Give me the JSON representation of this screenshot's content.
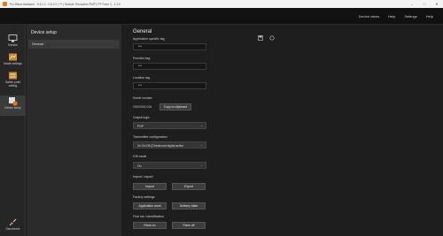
{
  "window": {
    "title": "Pro Warm Assistant - 9.3.1.0 - 2.8.2.0 | *** | Module: Receptive IPMT1 PF Ports *) - 1.2.0",
    "controls": [
      "–",
      "□",
      "✕"
    ]
  },
  "topmenu": {
    "items": [
      "Device views",
      "Help",
      "Settings",
      "Help"
    ]
  },
  "nav": {
    "items": [
      {
        "label": "Monitor",
        "icon": "monitor-icon"
      },
      {
        "label": "Model settings",
        "icon": "model-icon"
      },
      {
        "label": "Switch point setting",
        "icon": "switch-icon"
      },
      {
        "label": "Device setup",
        "icon": "device-setup-icon"
      }
    ],
    "bottom": {
      "label": "Disconnect",
      "icon": "disconnect-icon"
    }
  },
  "setup_panel": {
    "header": "Device setup",
    "items": [
      "General"
    ]
  },
  "general": {
    "title": "General",
    "app_tag_label": "Application specific tag",
    "app_tag_value": "***",
    "function_tag_label": "Function tag",
    "function_tag_value": "***",
    "location_tag_label": "Location tag",
    "location_tag_value": "***",
    "serial_label": "Serial number",
    "serial_value": "000000001234",
    "copy_button": "Copy to clipboard",
    "output_logic_label": "Output logic",
    "output_logic_value": "PNP",
    "transmitter_label": "Transmitter configuration",
    "transmitter_value": "2x On/Off (Directional digital active",
    "io_mode_label": "IO5 mode",
    "io_mode_value": "On",
    "import_export_label": "Import / export",
    "import_button": "Import",
    "export_button": "Export",
    "factory_label": "Factory settings",
    "app_reset_button": "Application reset",
    "delivery_button": "Delivery state",
    "find_label": "Find me / identification",
    "flash_on_button": "Flash on",
    "flash_off_button": "Flash off"
  }
}
